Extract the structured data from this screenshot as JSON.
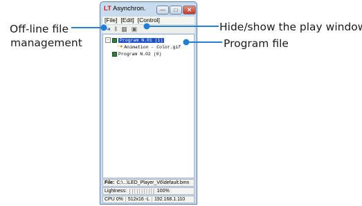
{
  "annotations": {
    "offline_line1": "Off-line file",
    "offline_line2": "management",
    "hide_show": "Hide/show the play window",
    "program_file": "Program file"
  },
  "window": {
    "title_prefix": "LT",
    "title_rest": " Asynchron.",
    "minimize_symbol": "—",
    "maximize_symbol": "□",
    "close_symbol": "✕"
  },
  "menu": {
    "file": "[File]",
    "edit": "[Edit]",
    "control": "[Control]"
  },
  "toolbar": {
    "icons": [
      "offline-file-icon",
      "pause-icon",
      "grid-icon",
      "window-toggle-icon"
    ],
    "offline_glyph": "⇥",
    "pause_glyph": "‖",
    "grid_glyph": "▦",
    "window_glyph": "▣"
  },
  "tree": {
    "program1": "Program N.01 (1)",
    "file1": "Animation - Color.gif",
    "program2": "Program N.02 (0)",
    "collapse_symbol": "−",
    "expand_symbol": "+"
  },
  "status": {
    "file_label": "File:",
    "file_path": "C:\\...\\LED_Player_V6\\default.bmn",
    "lightness_label": "Lightness:",
    "lightness_ticks": "│┆┆┆┆┆┆┆┆┆│",
    "lightness_value": "100%",
    "cpu": "CPU  0%",
    "resolution": "512x16 -L",
    "ip": "192.168.1.110"
  },
  "colors": {
    "accent_line": "#1e7fd4",
    "title_brand": "#d11d1d",
    "selection": "#1e50c8"
  }
}
